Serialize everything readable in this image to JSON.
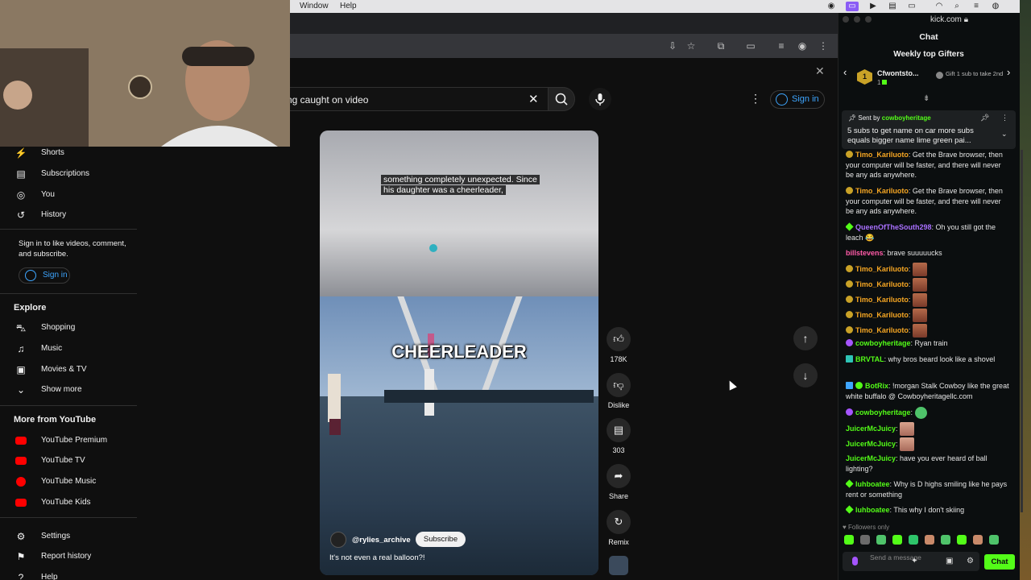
{
  "mac_menu": {
    "window": "Window",
    "help": "Help"
  },
  "youtube": {
    "search": {
      "value": "ng caught on video",
      "clear_icon": "close-icon",
      "search_icon": "search-icon",
      "mic_icon": "mic-icon"
    },
    "signin_top": "Sign in",
    "sidebar": {
      "main": [
        {
          "label": "Shorts",
          "icon": "shorts-icon"
        },
        {
          "label": "Subscriptions",
          "icon": "subscriptions-icon"
        },
        {
          "label": "You",
          "icon": "you-icon"
        },
        {
          "label": "History",
          "icon": "history-icon"
        }
      ],
      "signin_note": "Sign in to like videos, comment, and subscribe.",
      "signin_button": "Sign in",
      "explore_title": "Explore",
      "explore": [
        {
          "label": "Shopping",
          "icon": "shopping-icon"
        },
        {
          "label": "Music",
          "icon": "music-icon"
        },
        {
          "label": "Movies & TV",
          "icon": "movies-icon"
        },
        {
          "label": "Show more",
          "icon": "chevron-down-icon"
        }
      ],
      "more_title": "More from YouTube",
      "more": [
        {
          "label": "YouTube Premium"
        },
        {
          "label": "YouTube TV"
        },
        {
          "label": "YouTube Music"
        },
        {
          "label": "YouTube Kids"
        }
      ],
      "footer": [
        {
          "label": "Settings",
          "icon": "settings-icon"
        },
        {
          "label": "Report history",
          "icon": "flag-icon"
        },
        {
          "label": "Help",
          "icon": "help-icon"
        }
      ]
    },
    "short": {
      "caption_line1": "something completely unexpected. Since",
      "caption_line2": "his daughter was a cheerleader,",
      "overlay_title": "CHEERLEADER",
      "channel": "@rylies_archive",
      "subscribe": "Subscribe",
      "title": "It's not even a real balloon?!"
    },
    "actions": {
      "likes": "178K",
      "dislike": "Dislike",
      "comments": "303",
      "share": "Share",
      "remix": "Remix"
    }
  },
  "kick": {
    "url": "kick.com",
    "header": "Chat",
    "gifters_title": "Weekly top Gifters",
    "top_gifter": {
      "rank": "1",
      "name": "Cfwontsto...",
      "count": "1"
    },
    "gift_cta": "Gift 1 sub to take 2nd",
    "pinned": {
      "sent_by_label": "Sent by",
      "sender": "cowboyheritage",
      "message": "5 subs to get name on car more subs equals bigger name lime green pai..."
    },
    "messages": [
      {
        "user": "Timo_Kariluoto",
        "text": ": Get the Brave browser, then your computer will be faster, and there will never be any ads anywhere."
      },
      {
        "user": "Timo_Kariluoto",
        "text": ": Get the Brave browser, then your computer will be faster, and there will never be any ads anywhere."
      },
      {
        "user": "QueenOfTheSouth298",
        "text": ": Oh you still got the leach 😂"
      },
      {
        "user": "billstevens",
        "text": ": brave suuuuucks"
      },
      {
        "user": "Timo_Kariluoto",
        "text": ":"
      },
      {
        "user": "Timo_Kariluoto",
        "text": ":"
      },
      {
        "user": "Timo_Kariluoto",
        "text": ":"
      },
      {
        "user": "Timo_Kariluoto",
        "text": ":"
      },
      {
        "user": "Timo_Kariluoto",
        "text": ":"
      },
      {
        "user": "cowboyheritage",
        "text": ": Ryan train"
      },
      {
        "user": "BRVTAL",
        "text": ": why bros beard look like a shovel"
      },
      {
        "user": "BotRix",
        "text": ": !morgan Stalk Cowboy like the great white buffalo @ Cowboyheritagellc.com"
      },
      {
        "user": "cowboyheritage",
        "text": ":"
      },
      {
        "user": "JuicerMcJuicy",
        "text": ":"
      },
      {
        "user": "JuicerMcJuicy",
        "text": ":"
      },
      {
        "user": "JuicerMcJuicy",
        "text": ": have you ever heard of ball lighting?"
      },
      {
        "user": "luhboatee",
        "text": ": Why is D highs smiling like he pays rent or something"
      },
      {
        "user": "luhboatee",
        "text": ": This why I don't skiing"
      }
    ],
    "followers_only": "Followers only",
    "input_placeholder": "Send a message",
    "send_label": "Chat"
  },
  "colors": {
    "kick_green": "#53fc18",
    "yt_blue": "#3ea6ff",
    "yt_red": "#ff0000"
  }
}
